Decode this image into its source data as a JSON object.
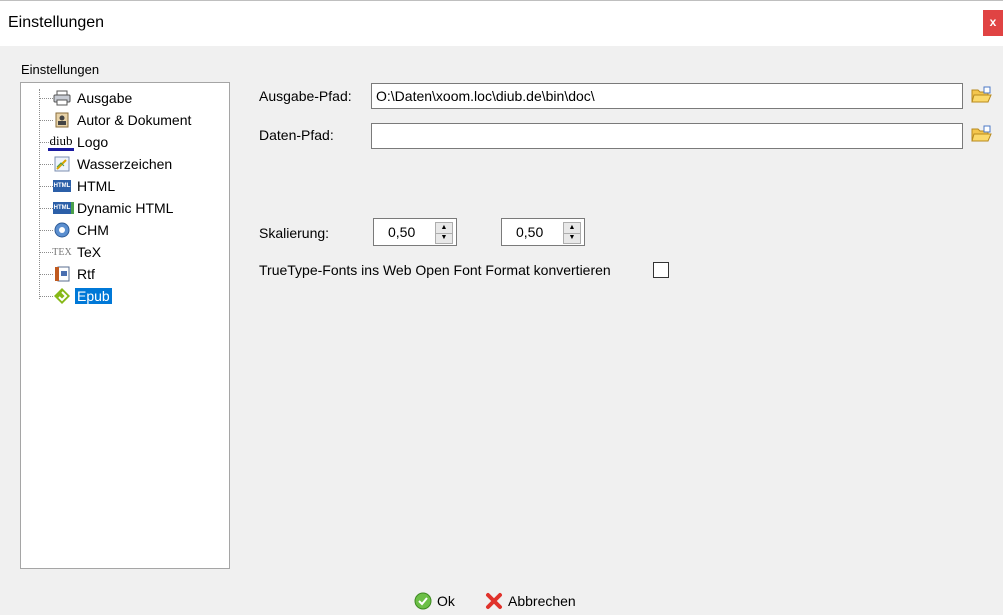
{
  "window": {
    "title": "Einstellungen",
    "close_label": "x"
  },
  "settings": {
    "group_label": "Einstellungen",
    "tree": [
      {
        "label": "Ausgabe",
        "icon": "printer-icon"
      },
      {
        "label": "Autor & Dokument",
        "icon": "author-icon"
      },
      {
        "label": "Logo",
        "icon": "diub-logo-icon",
        "icon_text": "diub"
      },
      {
        "label": "Wasserzeichen",
        "icon": "watermark-icon"
      },
      {
        "label": "HTML",
        "icon": "html-icon",
        "icon_text": "HTML"
      },
      {
        "label": "Dynamic HTML",
        "icon": "dynamic-html-icon",
        "icon_text": "HTML"
      },
      {
        "label": "CHM",
        "icon": "chm-help-icon"
      },
      {
        "label": "TeX",
        "icon": "tex-icon",
        "icon_text": "TEX"
      },
      {
        "label": "Rtf",
        "icon": "rtf-icon"
      },
      {
        "label": "Epub",
        "icon": "epub-icon",
        "selected": true
      }
    ]
  },
  "form": {
    "output_path_label": "Ausgabe-Pfad:",
    "output_path_value": "O:\\Daten\\xoom.loc\\diub.de\\bin\\doc\\",
    "data_path_label": "Daten-Pfad:",
    "data_path_value": "",
    "scale_label": "Skalierung:",
    "scale_x": "0,50",
    "scale_y": "0,50",
    "woff_label": "TrueType-Fonts ins Web Open Font Format konvertieren",
    "woff_checked": false
  },
  "buttons": {
    "ok": "Ok",
    "cancel": "Abbrechen"
  },
  "colors": {
    "selection": "#0078d7",
    "close": "#e04343"
  }
}
